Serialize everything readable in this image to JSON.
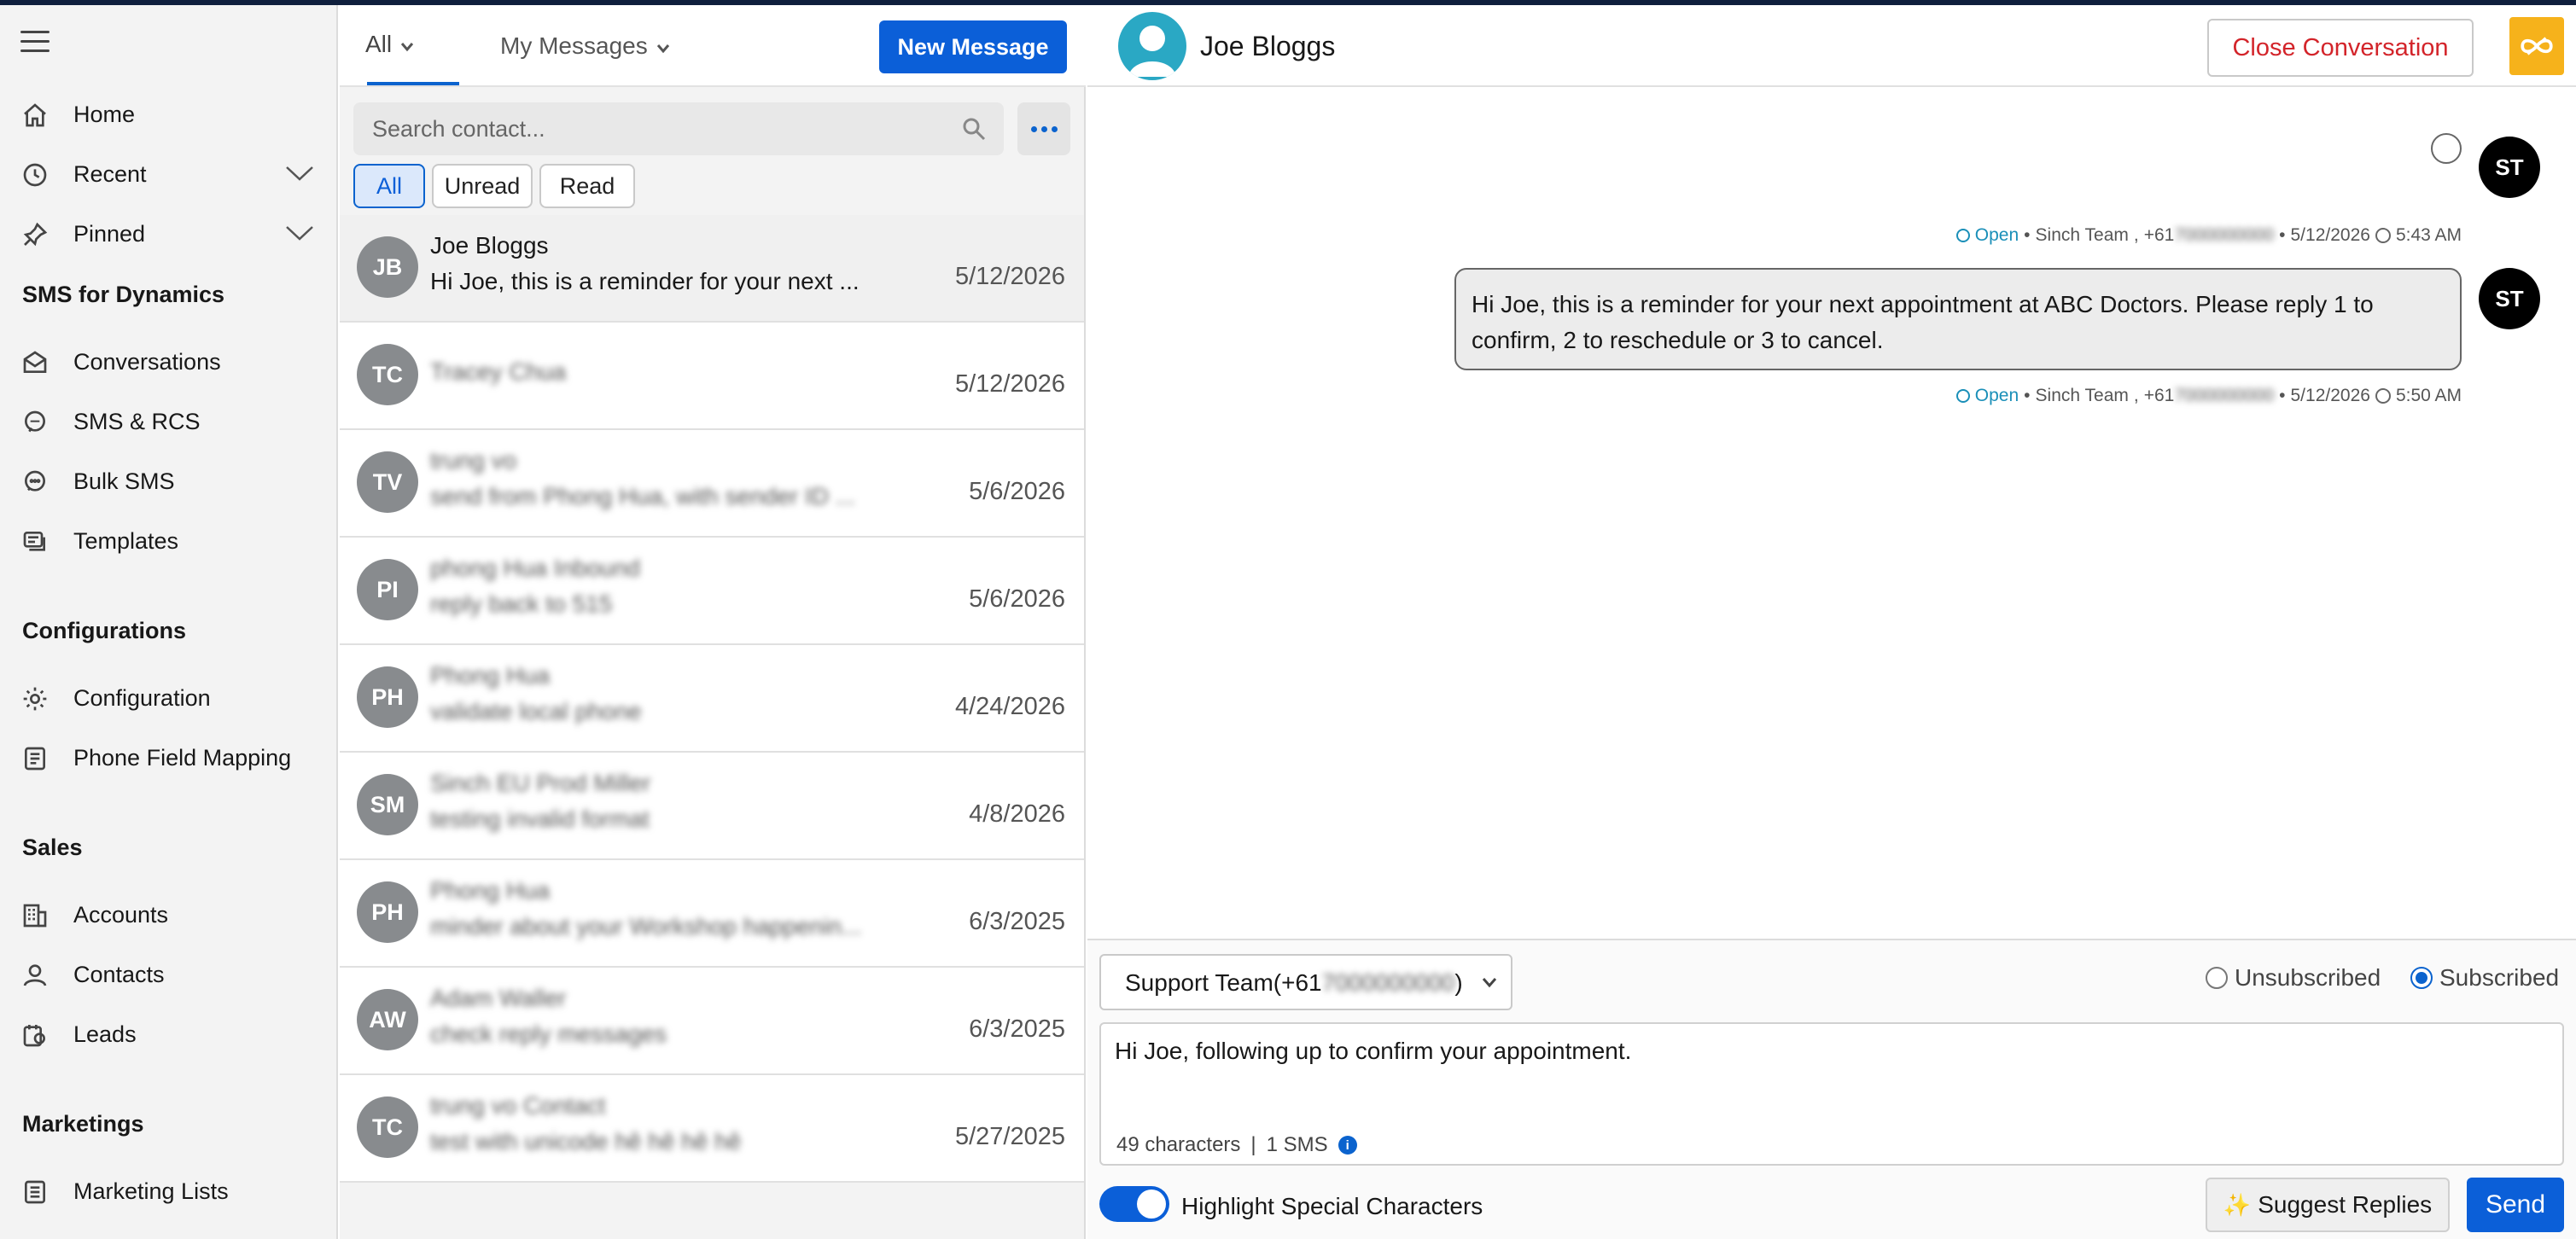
{
  "sidebar": {
    "items": [
      {
        "label": "Home",
        "icon": "home-icon"
      },
      {
        "label": "Recent",
        "icon": "clock-icon",
        "expandable": true
      },
      {
        "label": "Pinned",
        "icon": "pin-icon",
        "expandable": true
      }
    ],
    "sections": [
      {
        "title": "SMS for Dynamics",
        "items": [
          {
            "label": "Conversations",
            "icon": "conversations-icon"
          },
          {
            "label": "SMS & RCS",
            "icon": "sms-icon"
          },
          {
            "label": "Bulk SMS",
            "icon": "bulk-sms-icon"
          },
          {
            "label": "Templates",
            "icon": "templates-icon"
          }
        ]
      },
      {
        "title": "Configurations",
        "items": [
          {
            "label": "Configuration",
            "icon": "gear-icon"
          },
          {
            "label": "Phone Field Mapping",
            "icon": "mapping-icon"
          }
        ]
      },
      {
        "title": "Sales",
        "items": [
          {
            "label": "Accounts",
            "icon": "accounts-icon"
          },
          {
            "label": "Contacts",
            "icon": "contact-icon"
          },
          {
            "label": "Leads",
            "icon": "leads-icon"
          }
        ]
      },
      {
        "title": "Marketings",
        "items": [
          {
            "label": "Marketing Lists",
            "icon": "list-icon"
          }
        ]
      }
    ]
  },
  "list_panel": {
    "tabs": {
      "all": "All",
      "my_messages": "My Messages"
    },
    "new_message_label": "New Message",
    "search_placeholder": "Search contact...",
    "filters": [
      "All",
      "Unread",
      "Read"
    ],
    "active_filter": "All",
    "conversations": [
      {
        "initials": "JB",
        "name": "Joe Bloggs",
        "preview": "Hi Joe, this is a reminder for your next ...",
        "date": "5/12/2026",
        "blurred": false,
        "selected": true
      },
      {
        "initials": "TC",
        "name": "Tracey Chua",
        "preview": "",
        "date": "5/12/2026",
        "blurred": true
      },
      {
        "initials": "TV",
        "name": "trung vo",
        "preview": "send from Phong Hua, with sender ID ...",
        "date": "5/6/2026",
        "blurred": true
      },
      {
        "initials": "PI",
        "name": "phong Hua Inbound",
        "preview": "reply back to 515",
        "date": "5/6/2026",
        "blurred": true
      },
      {
        "initials": "PH",
        "name": "Phong Hua",
        "preview": "validate local phone",
        "date": "4/24/2026",
        "blurred": true
      },
      {
        "initials": "SM",
        "name": "Sinch EU Prod Miller",
        "preview": "testing invalid format",
        "date": "4/8/2026",
        "blurred": true
      },
      {
        "initials": "PH",
        "name": "Phong Hua",
        "preview": "minder about your Workshop happenin...",
        "date": "6/3/2025",
        "blurred": true
      },
      {
        "initials": "AW",
        "name": "Adam Waller",
        "preview": "check reply messages",
        "date": "6/3/2025",
        "blurred": true
      },
      {
        "initials": "TC",
        "name": "trung vo Contact",
        "preview": "test with unicode hê hê hê hê",
        "date": "5/27/2025",
        "blurred": true
      }
    ]
  },
  "chat": {
    "contact_name": "Joe Bloggs",
    "close_label": "Close Conversation",
    "messages": [
      {
        "sender_initials": "ST",
        "text": "",
        "status": "Open",
        "team": "Sinch Team",
        "phone_visible": "+61",
        "phone_blurred": "7000000000",
        "date": "5/12/2026",
        "time": "5:43 AM"
      },
      {
        "sender_initials": "ST",
        "text": "Hi Joe, this is a reminder for your next appointment at ABC Doctors. Please reply 1 to confirm, 2 to reschedule or 3 to cancel.",
        "status": "Open",
        "team": "Sinch Team",
        "phone_visible": "+61",
        "phone_blurred": "7000000000",
        "date": "5/12/2026",
        "time": "5:50 AM"
      }
    ],
    "composer": {
      "sender_label_prefix": "Support Team(+61",
      "sender_label_blurred": "7000000000",
      "sender_label_suffix": ")",
      "unsubscribed_label": "Unsubscribed",
      "subscribed_label": "Subscribed",
      "subscription": "Subscribed",
      "draft": "Hi Joe, following up to confirm your appointment.",
      "char_count": "49 characters",
      "separator": "|",
      "sms_count": "1 SMS",
      "highlight_label": "Highlight Special Characters",
      "highlight_on": true,
      "suggest_label": "Suggest Replies",
      "send_label": "Send"
    }
  },
  "colors": {
    "brand_blue": "#0b5fd8",
    "danger_red": "#d3242a",
    "status_teal": "#1a8fb8",
    "logo_yellow": "#f6b21b"
  }
}
